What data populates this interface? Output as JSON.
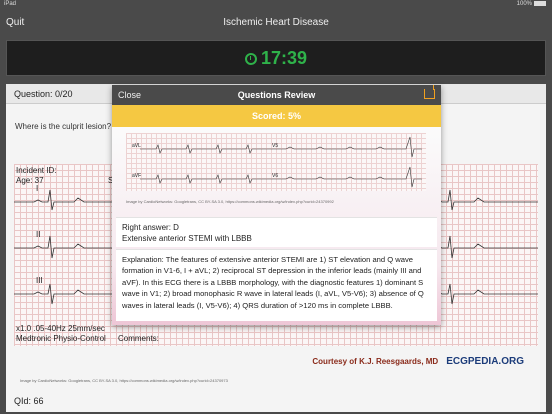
{
  "statusbar": {
    "left": "iPad",
    "right": "100%"
  },
  "navbar": {
    "quit_label": "Quit",
    "title": "Ischemic Heart Disease"
  },
  "timer": {
    "value": "17:39",
    "color": "#2fb24a"
  },
  "question_panel": {
    "header": "Question: 0/20",
    "question": "Where is the culprit lesion?",
    "ecg": {
      "incident_id_label": "Incident ID:",
      "age_label": "Age: 37",
      "partial_lead": "S",
      "lead_labels": [
        "I",
        "II",
        "III"
      ],
      "filter_info": "x1.0 .05-40Hz 25mm/sec",
      "device": "Medtronic Physio-Control",
      "comments_label": "Comments:",
      "credit_name": "Courtesy of K.J. Reesgaards, MD",
      "credit_brand": "ECGPEDIA.ORG",
      "image_credit": "Image by CardioNetworks: Googletrans, CC BY-SA 3.0, https://commons.wikimedia.org/w/index.php?curid=24370973"
    },
    "qid": "QId: 66"
  },
  "modal": {
    "close_label": "Close",
    "title": "Questions Review",
    "score_label": "Scored: 5%",
    "image_leads": [
      "aVL",
      "V5",
      "aVF",
      "V6"
    ],
    "image_credit": "Image by CardioNetworks: Googletrans, CC BY-SA 3.0, https://commons.wikimedia.org/w/index.php?curid=24370992",
    "right_answer": "Right answer: D",
    "answer_text": "Extensive anterior STEMI with LBBB",
    "explanation": "Explanation: The features of extensive anterior STEMI are 1) ST elevation and Q wave formation in V1-6, I + aVL; 2) reciprocal ST depression in the inferior leads (mainly III and aVF). In this ECG there is a LBBB morphology, with the diagnostic features 1) dominant S wave in V1; 2) broad monophasic R wave in lateral leads (I, aVL, V5-V6); 3) absence of Q waves in lateral leads (I, V5-V6); 4) QRS duration of >120 ms in complete LBBB."
  },
  "colors": {
    "score_bar": "#f5c842",
    "nav_bg": "#4a4a4a",
    "share_icon": "#f0a020"
  }
}
